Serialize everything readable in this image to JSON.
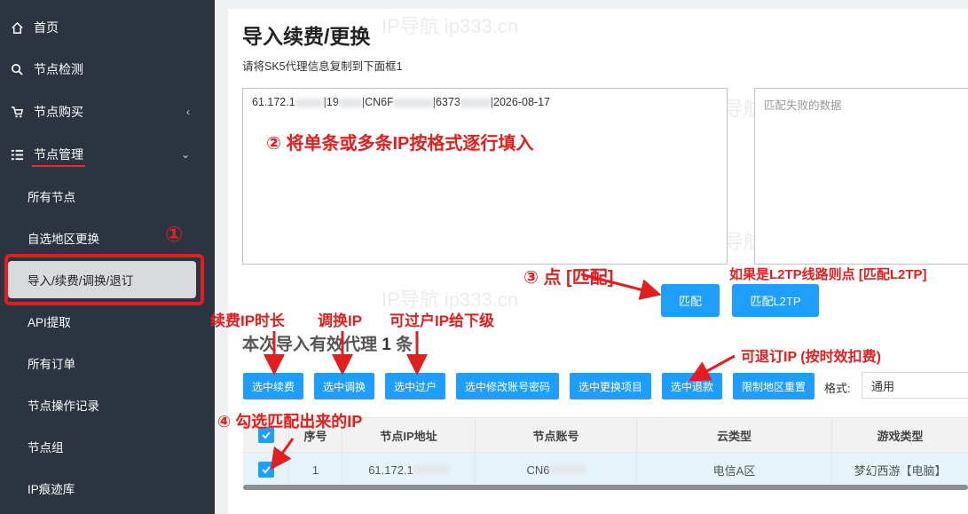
{
  "sidebar": {
    "items": [
      {
        "label": "首页",
        "icon": "home-icon"
      },
      {
        "label": "节点检测",
        "icon": "search-icon"
      },
      {
        "label": "节点购买",
        "icon": "cart-icon"
      },
      {
        "label": "节点管理",
        "icon": "list-icon"
      }
    ],
    "subitems": [
      "所有节点",
      "自选地区更换",
      "导入/续费/调换/退订",
      "API提取",
      "所有订单",
      "节点操作记录",
      "节点组",
      "IP痕迹库"
    ]
  },
  "page": {
    "title": "导入续费/更换",
    "hint": "请将SK5代理信息复制到下面框1",
    "input_parts": [
      "61.172.1",
      "|19",
      "|CN6F",
      "|6373",
      "|2026-08-17"
    ],
    "fail_placeholder": "匹配失败的数据",
    "match_button": "匹配",
    "match_l2tp_button": "匹配L2TP",
    "summary_prefix": "本次导入有效代理",
    "summary_count": "1",
    "summary_suffix": "条",
    "actions": [
      "选中续费",
      "选中调换",
      "选中过户",
      "选中修改账号密码",
      "选中更换项目",
      "选中退款",
      "限制地区重置"
    ],
    "format_label": "格式:",
    "format_value": "通用"
  },
  "table": {
    "headers": [
      "序号",
      "节点IP地址",
      "节点账号",
      "云类型",
      "游戏类型"
    ],
    "rows": [
      {
        "index": "1",
        "ip": "61.172.1",
        "account": "CN6",
        "cloud": "电信A区",
        "game": "梦幻西游【电脑】"
      }
    ]
  },
  "annotations": {
    "step1": "①",
    "step2": "② 将单条或多条IP按格式逐行填入",
    "step3": "③ 点 [匹配]",
    "step4": "④ 勾选匹配出来的IP",
    "l2tp_note": "如果是L2TP线路则点 [匹配L2TP]",
    "renew_note": "续费IP时长",
    "swap_note": "调换IP",
    "transfer_note": "可过户IP给下级",
    "refund_note": "可退订IP (按时效扣费)"
  },
  "watermark": "IP导航  ip333.cn",
  "colors": {
    "accent": "#1e9fff",
    "annotation": "#e31e1e",
    "sidebar": "#2c3442"
  }
}
